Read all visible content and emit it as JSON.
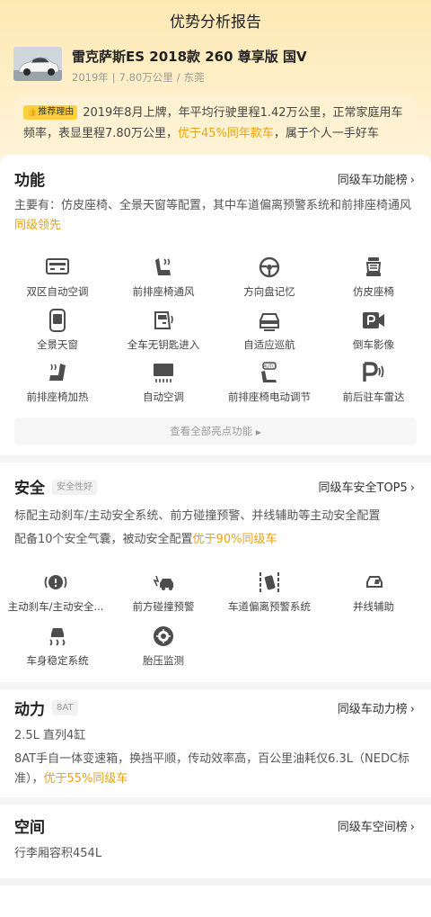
{
  "page": {
    "title": "优势分析报告"
  },
  "car": {
    "name": "雷克萨斯ES 2018款 260 尊享版 国V",
    "year": "2019年",
    "mileage": "7.80万公里",
    "city": "东莞"
  },
  "reason": {
    "tag": "推荐理由",
    "text_before": "2019年8月上牌，年平均行驶里程1.42万公里，正常家庭用车频率，表显里程7.80万公里，",
    "highlight": "优于45%同年款车",
    "text_after": "，属于个人一手好车"
  },
  "functions": {
    "title": "功能",
    "link": "同级车功能榜",
    "desc_before": "主要有：仿皮座椅、全景天窗等配置，其中车道偏离预警系统和前排座椅通风",
    "desc_highlight": "同级领先",
    "items": [
      {
        "label": "双区自动空调",
        "icon": "dual-zone-ac-icon"
      },
      {
        "label": "前排座椅通风",
        "icon": "seat-ventilation-icon"
      },
      {
        "label": "方向盘记忆",
        "icon": "steering-wheel-icon"
      },
      {
        "label": "仿皮座椅",
        "icon": "leather-seat-icon"
      },
      {
        "label": "全景天窗",
        "icon": "panoramic-sunroof-icon"
      },
      {
        "label": "全车无钥匙进入",
        "icon": "keyless-entry-icon"
      },
      {
        "label": "自适应巡航",
        "icon": "adaptive-cruise-icon"
      },
      {
        "label": "倒车影像",
        "icon": "rear-camera-icon"
      },
      {
        "label": "前排座椅加热",
        "icon": "seat-heating-icon"
      },
      {
        "label": "自动空调",
        "icon": "auto-ac-icon"
      },
      {
        "label": "前排座椅电动调节",
        "icon": "power-seat-icon"
      },
      {
        "label": "前后驻车雷达",
        "icon": "parking-radar-icon"
      }
    ],
    "view_all": "查看全部亮点功能"
  },
  "safety": {
    "title": "安全",
    "badge": "安全性好",
    "link": "同级车安全TOP5",
    "desc_line1": "标配主动刹车/主动安全系统、前方碰撞预警、并线辅助等主动安全配置",
    "desc_line2_before": "配备10个安全气囊，被动安全配置",
    "desc_line2_highlight": "优于90%同级车",
    "items": [
      {
        "label": "主动刹车/主动安全...",
        "icon": "active-brake-icon"
      },
      {
        "label": "前方碰撞预警",
        "icon": "collision-warning-icon"
      },
      {
        "label": "车道偏离预警系统",
        "icon": "lane-departure-icon"
      },
      {
        "label": "并线辅助",
        "icon": "blind-spot-icon"
      },
      {
        "label": "车身稳定系统",
        "icon": "stability-control-icon"
      },
      {
        "label": "胎压监测",
        "icon": "tire-pressure-icon"
      }
    ]
  },
  "power": {
    "title": "动力",
    "badge": "8AT",
    "link": "同级车动力榜",
    "engine": "2.5L 直列4缸",
    "desc_before": "8AT手自一体变速箱，换挡平顺，传动效率高，百公里油耗仅6.3L（NEDC标准），",
    "desc_highlight": "优于55%同级车"
  },
  "space": {
    "title": "空间",
    "link": "同级车空间榜",
    "desc": "行李厢容积454L"
  },
  "colors": {
    "accent": "#e8a213",
    "hero_top": "#fde9b3",
    "tag": "#ffcf3e",
    "icon": "#4d4d4d"
  }
}
